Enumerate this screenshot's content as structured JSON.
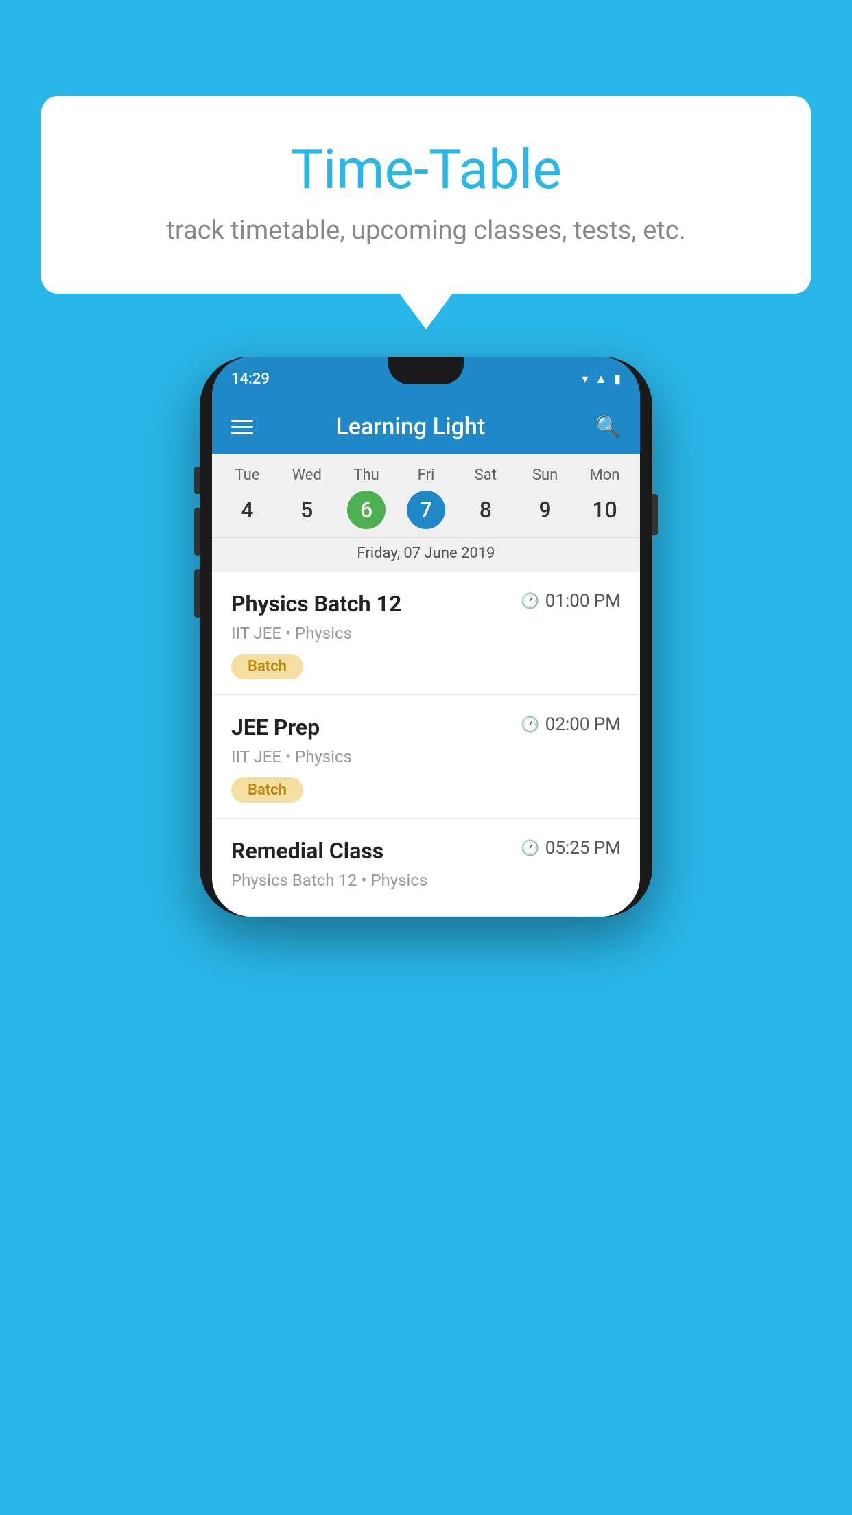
{
  "background_color": "#29b6e8",
  "bubble": {
    "title": "Time-Table",
    "subtitle": "track timetable, upcoming classes, tests, etc."
  },
  "phone": {
    "status_bar": {
      "time": "14:29"
    },
    "app_header": {
      "title": "Learning Light"
    },
    "calendar": {
      "days": [
        {
          "name": "Tue",
          "num": "4",
          "state": "normal"
        },
        {
          "name": "Wed",
          "num": "5",
          "state": "normal"
        },
        {
          "name": "Thu",
          "num": "6",
          "state": "today"
        },
        {
          "name": "Fri",
          "num": "7",
          "state": "selected"
        },
        {
          "name": "Sat",
          "num": "8",
          "state": "normal"
        },
        {
          "name": "Sun",
          "num": "9",
          "state": "normal"
        },
        {
          "name": "Mon",
          "num": "10",
          "state": "normal"
        }
      ],
      "selected_date": "Friday, 07 June 2019"
    },
    "schedule": [
      {
        "title": "Physics Batch 12",
        "time": "01:00 PM",
        "sub": "IIT JEE • Physics",
        "badge": "Batch"
      },
      {
        "title": "JEE Prep",
        "time": "02:00 PM",
        "sub": "IIT JEE • Physics",
        "badge": "Batch"
      },
      {
        "title": "Remedial Class",
        "time": "05:25 PM",
        "sub": "Physics Batch 12 • Physics",
        "badge": null
      }
    ]
  }
}
